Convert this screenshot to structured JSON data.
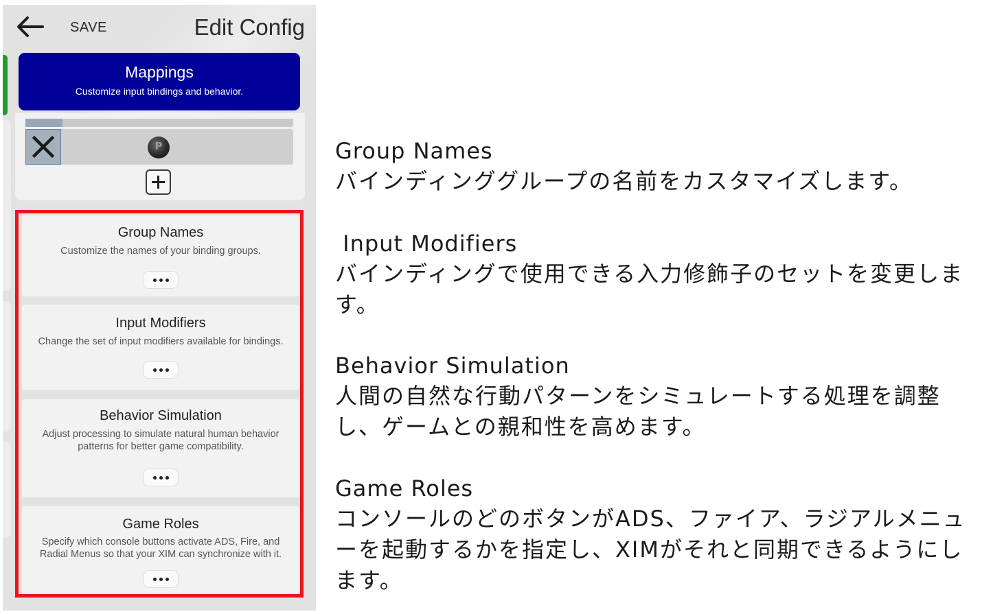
{
  "topbar": {
    "save_label": "SAVE",
    "title": "Edit Config"
  },
  "mappings": {
    "title": "Mappings",
    "subtitle": "Customize input bindings and behavior."
  },
  "cards": [
    {
      "title": "Group Names",
      "description": "Customize the names of your binding groups."
    },
    {
      "title": "Input Modifiers",
      "description": "Change the set of input modifiers available for bindings."
    },
    {
      "title": "Behavior Simulation",
      "description": "Adjust processing to simulate natural human behavior patterns for better game compatibility."
    },
    {
      "title": "Game Roles",
      "description": "Specify which console buttons activate ADS, Fire, and Radial Menus so that your XIM can synchronize with it."
    }
  ],
  "annotations": [
    {
      "heading": "Group Names",
      "body": "バインディンググループの名前をカスタマイズします。"
    },
    {
      "heading": " Input Modifiers",
      "body": "バインディングで使用できる入力修飾子のセットを変更します。"
    },
    {
      "heading": "Behavior Simulation",
      "body": "人間の自然な行動パターンをシミュレートする処理を調整し、ゲームとの親和性を高めます。"
    },
    {
      "heading": "Game Roles",
      "body": "コンソールのどのボタンがADS、ファイア、ラジアルメニューを起動するかを指定し、XIMがそれと同期できるようにします。"
    }
  ],
  "icons": {
    "back": "arrow-left-icon",
    "remove": "close-x-icon",
    "controller_button": "playstation-button-icon",
    "add": "plus-icon",
    "more": "ellipsis-icon"
  },
  "colors": {
    "mappings_bg": "#01019a",
    "highlight_border": "#e8151b",
    "side_tab": "#1f9d2c"
  }
}
